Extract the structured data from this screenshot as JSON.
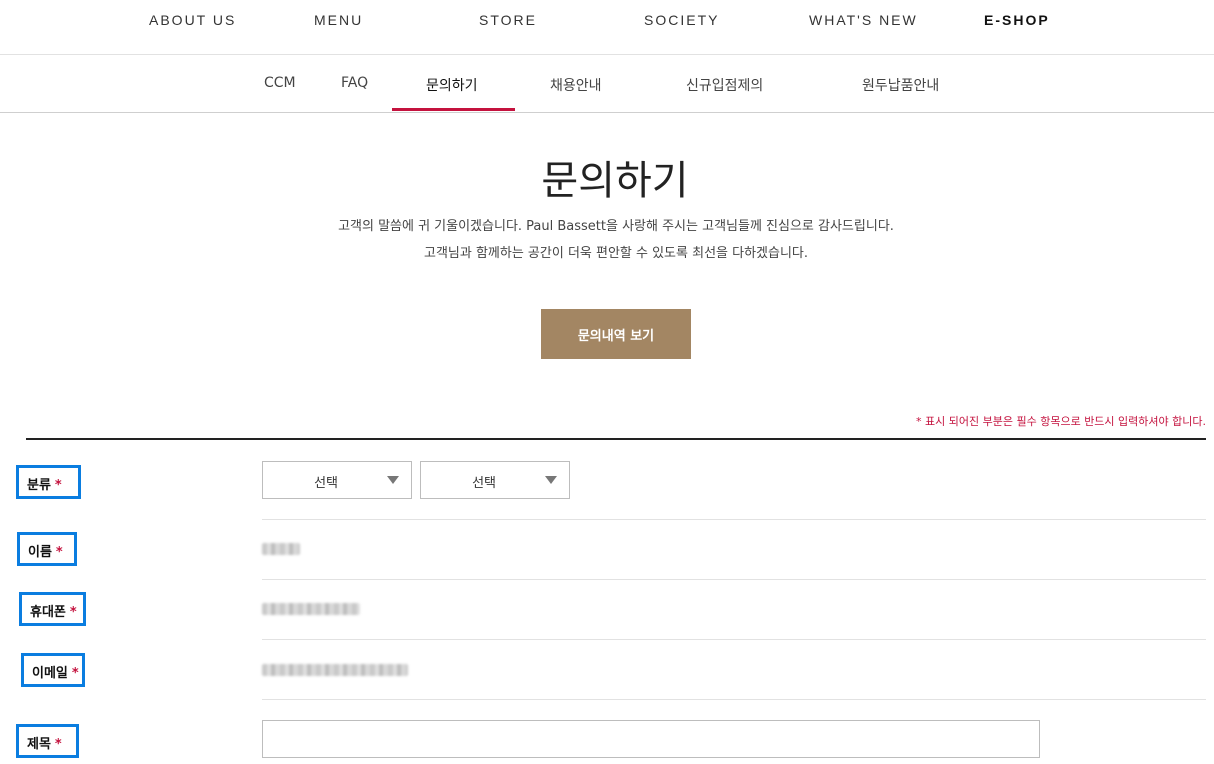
{
  "gnb": {
    "items": [
      "ABOUT US",
      "MENU",
      "STORE",
      "SOCIETY",
      "WHAT'S NEW",
      "E-SHOP"
    ]
  },
  "lnb": {
    "items": [
      "CCM",
      "FAQ",
      "문의하기",
      "채용안내",
      "신규입점제의",
      "원두납품안내"
    ],
    "active": "문의하기"
  },
  "page": {
    "title": "문의하기",
    "desc_line1": "고객의 말씀에 귀 기울이겠습니다. Paul Bassett을 사랑해 주시는 고객님들께 진심으로 감사드립니다.",
    "desc_line2": "고객님과 함께하는 공간이 더욱 편안할 수 있도록 최선을 다하겠습니다.",
    "history_button": "문의내역 보기",
    "required_note": "* 표시 되어진 부분은 필수 항목으로 반드시 입력하셔야 합니다."
  },
  "form": {
    "required_mark": "*",
    "category_label": "분류",
    "category_select1": "선택",
    "category_select2": "선택",
    "name_label": "이름",
    "phone_label": "휴대폰",
    "email_label": "이메일",
    "subject_label": "제목",
    "subject_value": ""
  },
  "colors": {
    "accent": "#c4123e",
    "brand_button": "#a38663",
    "annotation_box": "#0a7de0"
  }
}
